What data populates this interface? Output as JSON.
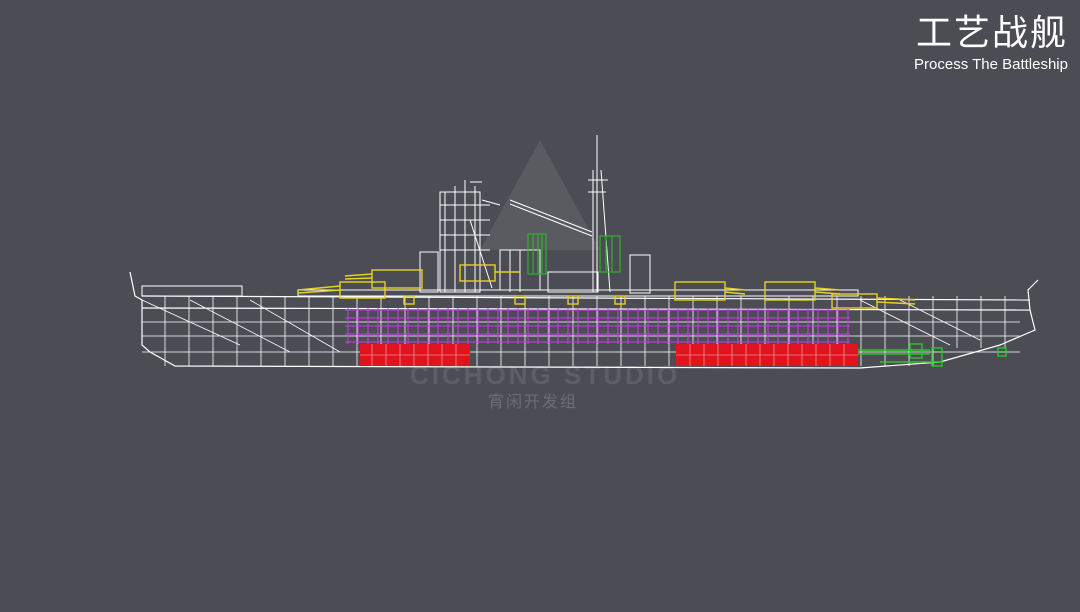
{
  "title": {
    "cn": "工艺战舰",
    "en": "Process The Battleship"
  },
  "watermark": {
    "line1": "CICHONG STUDIO",
    "line2": "宵闲开发组"
  },
  "colors": {
    "background": "#4c4c54",
    "hull_lines": "#ffffff",
    "turrets": "#e6d21e",
    "internal_grid": "#c040e0",
    "engine_rooms": "#e0141e",
    "rudder_propellers": "#28c828",
    "masts_green": "#28b428"
  }
}
